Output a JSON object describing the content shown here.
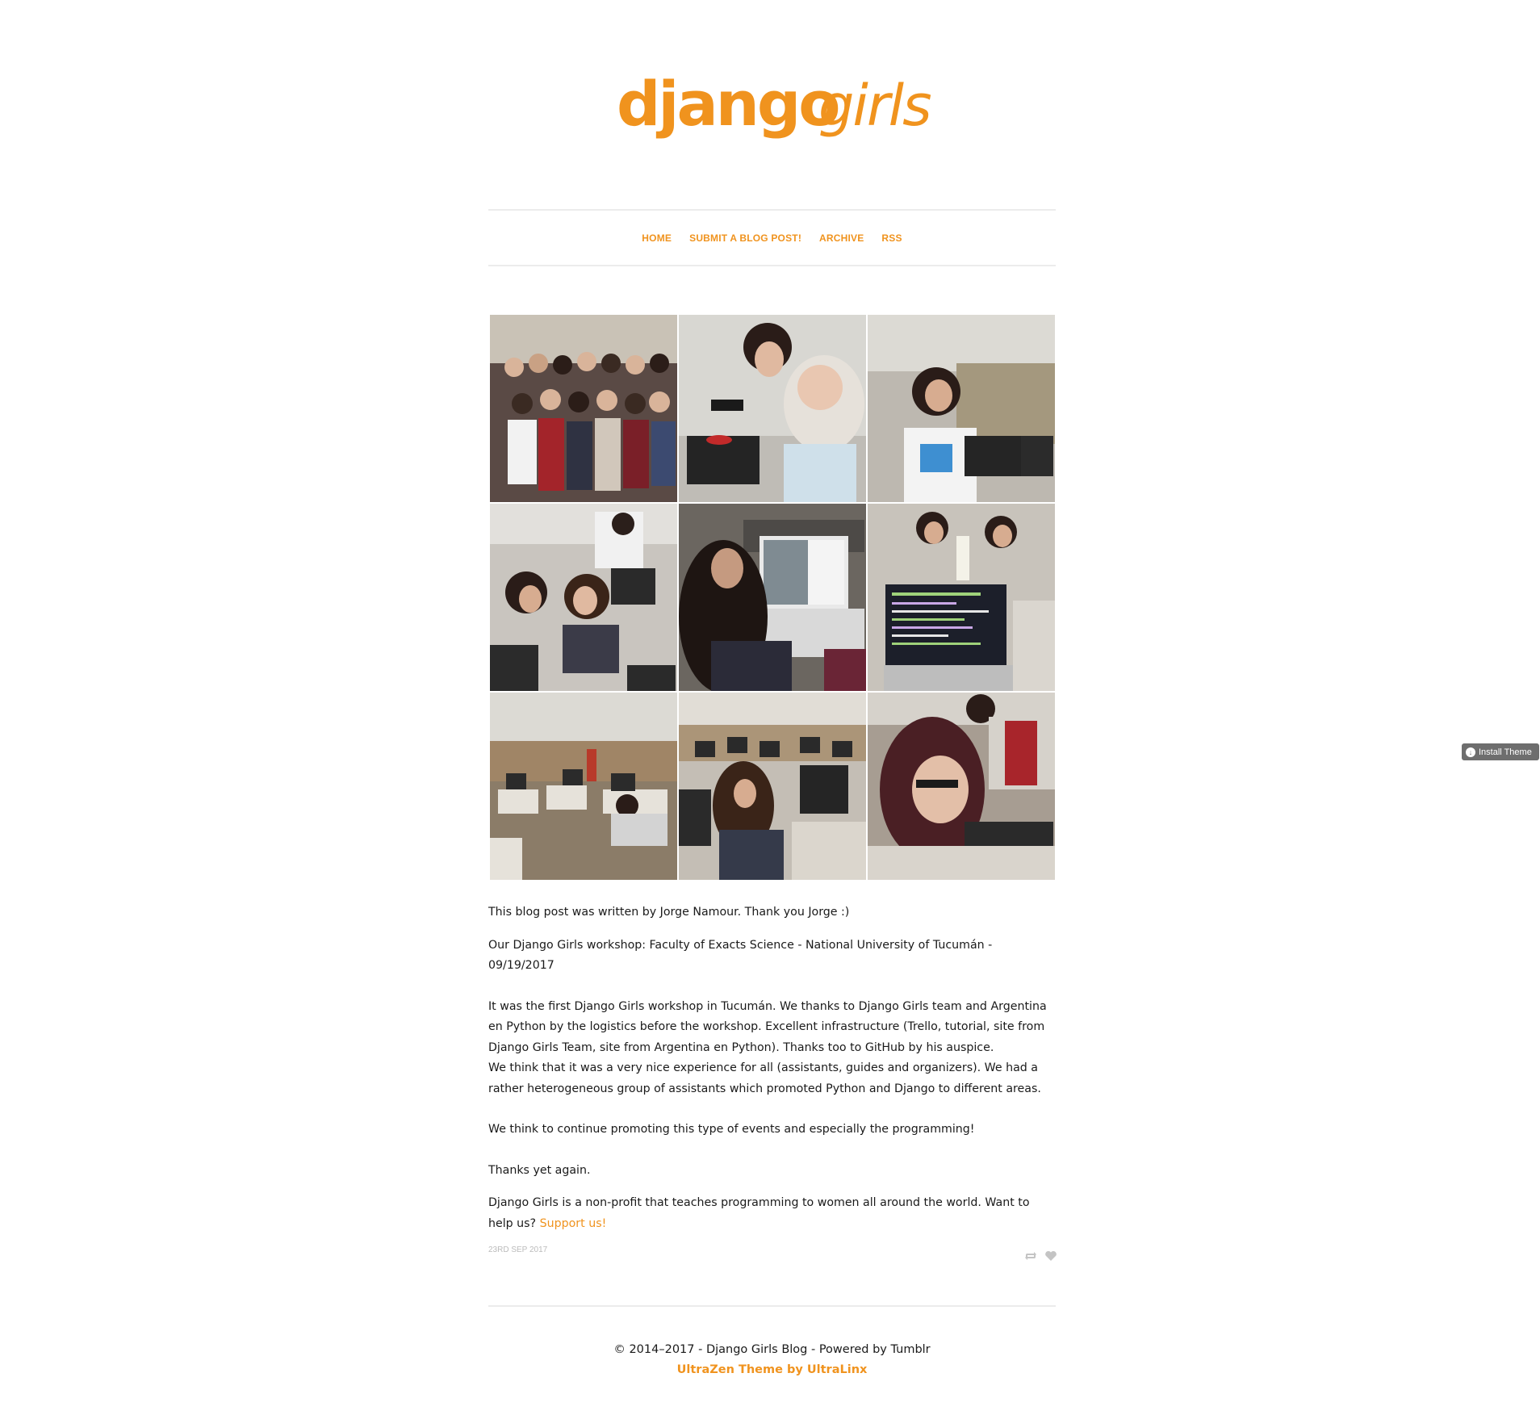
{
  "logo": {
    "text_bold": "django",
    "text_script": "girls",
    "color": "#f0931e"
  },
  "nav": {
    "items": [
      {
        "label": "HOME"
      },
      {
        "label": "SUBMIT A BLOG POST!"
      },
      {
        "label": "ARCHIVE"
      },
      {
        "label": "RSS"
      }
    ]
  },
  "photos": [
    {
      "icon": "group-photo"
    },
    {
      "icon": "laptop-photo"
    },
    {
      "icon": "classroom-photo"
    },
    {
      "icon": "classroom-photo"
    },
    {
      "icon": "laptop-photo"
    },
    {
      "icon": "laptop-photo"
    },
    {
      "icon": "classroom-photo"
    },
    {
      "icon": "classroom-photo"
    },
    {
      "icon": "laptop-photo"
    }
  ],
  "post": {
    "intro": "This blog post was written by Jorge Namour. Thank you Jorge :)",
    "workshop_line1": "Our Django Girls workshop: Faculty of Exacts Science - National University of Tucumán  -",
    "workshop_line2": "09/19/2017",
    "para1": "It was the first Django Girls workshop in Tucumán. We thanks to Django Girls team and Argentina en Python by the logistics before the workshop. Excellent infrastructure (Trello, tutorial, site from Django Girls Team, site from Argentina en Python). Thanks too to GitHub by his auspice.",
    "para2": "We think that it was a very nice experience for all (assistants, guides and organizers). We had a rather heterogeneous group of assistants which promoted Python and Django to different areas.",
    "para3": "We think to continue promoting this type of events and especially the programming!",
    "para4": "Thanks yet again.",
    "support_text": "Django Girls is a non-profit that teaches programming to women all around the world. Want to help us? ",
    "support_link": "Support us!",
    "date": "23RD SEP 2017"
  },
  "footer": {
    "copyright": "© 2014–2017 - Django Girls Blog - Powered by Tumblr",
    "credit": "UltraZen Theme by UltraLinx"
  },
  "install": {
    "label": "Install Theme"
  },
  "colors": {
    "accent": "#f0931e",
    "rule": "#ececec",
    "muted": "#bbbbbb"
  }
}
